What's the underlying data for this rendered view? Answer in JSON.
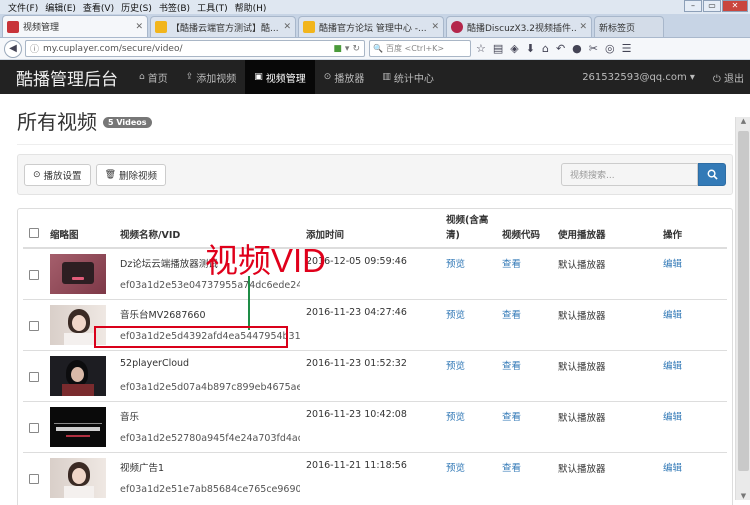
{
  "browser": {
    "menu": [
      "文件(F)",
      "编辑(E)",
      "查看(V)",
      "历史(S)",
      "书签(B)",
      "工具(T)",
      "帮助(H)"
    ],
    "tabs": [
      {
        "title": "视频管理",
        "color": "#c8343a",
        "active": true
      },
      {
        "title": "【酷播云端官方测试】酷...",
        "color": "#f2b51c",
        "active": false
      },
      {
        "title": "酷播官方论坛 管理中心 -...",
        "color": "#f2b51c",
        "active": false
      },
      {
        "title": "酷播DiscuzX3.2视频插件...",
        "color": "#b4264b",
        "active": false
      },
      {
        "title": "新标签页",
        "color": "",
        "active": false
      }
    ],
    "url": "my.cuplayer.com/secure/video/",
    "search_placeholder": "百度 <Ctrl+K>"
  },
  "app": {
    "brand": "酷播管理后台",
    "nav": [
      {
        "label": "首页",
        "icon": "home-icon",
        "glyph": "⌂",
        "active": false
      },
      {
        "label": "添加视频",
        "icon": "upload-icon",
        "glyph": "⇪",
        "active": false
      },
      {
        "label": "视频管理",
        "icon": "film-icon",
        "glyph": "▣",
        "active": true
      },
      {
        "label": "播放器",
        "icon": "play-circle-icon",
        "glyph": "⊙",
        "active": false
      },
      {
        "label": "统计中心",
        "icon": "stats-icon",
        "glyph": "▥",
        "active": false
      }
    ],
    "user": "261532593@qq.com ▾",
    "logout": "退出"
  },
  "page": {
    "title": "所有视频",
    "badge": "5 Videos",
    "toolbar": {
      "play_settings": "播放设置",
      "delete_video": "删除视频",
      "search_placeholder": "视频搜索..."
    }
  },
  "table": {
    "headers": {
      "thumbnail": "缩略图",
      "name_vid": "视频名称/VID",
      "added": "添加时间",
      "video": "视频(含高清)",
      "code": "视频代码",
      "player": "使用播放器",
      "action": "操作"
    },
    "rows": [
      {
        "name": "Dz论坛云端播放器测试",
        "vid": "ef03a1d2e53e04737955a74dc6ede24c",
        "time": "2016-12-05 09:59:46",
        "preview": "预览",
        "code": "查看",
        "player": "默认播放器",
        "edit": "编辑",
        "thumb": "pink"
      },
      {
        "name": "音乐台MV2687660",
        "vid": "ef03a1d2e5d4392afd4ea5447954b31e",
        "time": "2016-11-23 04:27:46",
        "preview": "预览",
        "code": "查看",
        "player": "默认播放器",
        "edit": "编辑",
        "thumb": "portrait-light"
      },
      {
        "name": "52playerCloud",
        "vid": "ef03a1d2e5d07a4b897c899eb4675ae8",
        "time": "2016-11-23 01:52:32",
        "preview": "预览",
        "code": "查看",
        "player": "默认播放器",
        "edit": "编辑",
        "thumb": "portrait-dark"
      },
      {
        "name": "音乐",
        "vid": "ef03a1d2e52780a945f4e24a703fd4ad",
        "time": "2016-11-23 10:42:08",
        "preview": "预览",
        "code": "查看",
        "player": "默认播放器",
        "edit": "编辑",
        "thumb": "number-nine"
      },
      {
        "name": "视频广告1",
        "vid": "ef03a1d2e51e7ab85684ce765ce9690b",
        "time": "2016-11-21 11:18:56",
        "preview": "预览",
        "code": "查看",
        "player": "默认播放器",
        "edit": "编辑",
        "thumb": "portrait-light"
      }
    ]
  },
  "annotation": {
    "label": "视频VID",
    "label_color": "#e0001b",
    "line_color": "#1e8c46"
  }
}
